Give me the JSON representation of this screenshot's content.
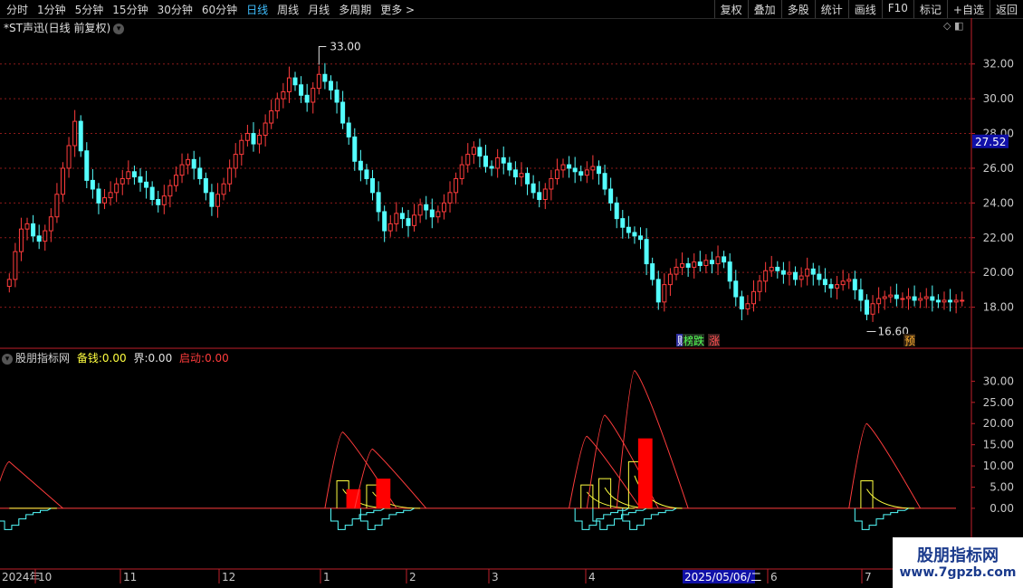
{
  "toolbar": {
    "periods": [
      "分时",
      "1分钟",
      "5分钟",
      "15分钟",
      "30分钟",
      "60分钟",
      "日线",
      "周线",
      "月线",
      "多周期",
      "更多 >"
    ],
    "active_period": "日线",
    "tools": [
      "复权",
      "叠加",
      "多股",
      "统计",
      "画线",
      "F10",
      "标记",
      "+自选",
      "返回"
    ]
  },
  "stock_title": "*ST声迅(日线 前复权)",
  "indicator": {
    "name": "股朋指标网",
    "beiqian_label": "备钱:",
    "beiqian_value": "0.00",
    "jie_label": "界:",
    "jie_value": "0.00",
    "qidong_label": "启动:",
    "qidong_value": "0.00"
  },
  "watermark": {
    "line1": "股朋指标网",
    "line2": "www.7gpzb.com"
  },
  "colors": {
    "up": "#ff3c3c",
    "down": "#54ffff",
    "axis": "#c0202a",
    "grid": "#8b1a1a",
    "label_bg": "#1010a8",
    "bar": "#ff0000",
    "yellow": "#ffff40",
    "cyan": "#54ffff",
    "white": "#ffffff",
    "text_tick": "#c8c8c8"
  },
  "chart_data": [
    {
      "type": "candlestick",
      "yticks": [
        18.0,
        20.0,
        22.0,
        24.0,
        26.0,
        28.0,
        30.0,
        32.0
      ],
      "ylim": [
        16.0,
        33.6
      ],
      "current_price": "27.52",
      "high_annotation": "33.00",
      "low_annotation": "16.60",
      "event_tags": [
        "财",
        "榜",
        "跌",
        "涨",
        "预"
      ],
      "closes": [
        19.6,
        21.2,
        22.5,
        22.8,
        22.1,
        21.8,
        22.4,
        23.2,
        24.5,
        26.0,
        27.3,
        28.7,
        27.0,
        25.3,
        24.8,
        24.0,
        24.3,
        24.6,
        25.1,
        25.4,
        25.8,
        25.5,
        25.2,
        24.9,
        24.2,
        23.9,
        24.4,
        25.0,
        25.6,
        26.2,
        26.5,
        26.0,
        25.4,
        24.6,
        23.8,
        24.5,
        25.1,
        26.0,
        26.8,
        27.6,
        28.0,
        27.4,
        27.9,
        28.6,
        29.3,
        30.0,
        30.4,
        31.2,
        30.8,
        30.2,
        29.8,
        30.6,
        31.4,
        31.0,
        30.5,
        29.8,
        28.6,
        27.8,
        26.4,
        25.9,
        25.4,
        24.6,
        23.5,
        22.4,
        22.8,
        23.4,
        23.1,
        22.7,
        23.3,
        23.9,
        23.6,
        23.2,
        23.5,
        24.0,
        24.6,
        25.4,
        26.2,
        26.8,
        27.2,
        26.7,
        26.1,
        26.0,
        26.6,
        26.3,
        25.9,
        25.5,
        25.7,
        25.1,
        24.6,
        24.2,
        24.8,
        25.4,
        25.9,
        26.2,
        26.0,
        25.8,
        25.6,
        25.9,
        26.1,
        25.7,
        24.8,
        24.0,
        23.1,
        22.6,
        22.3,
        22.1,
        21.9,
        20.5,
        19.6,
        18.3,
        19.3,
        19.9,
        20.3,
        20.5,
        20.3,
        20.6,
        20.4,
        20.7,
        20.5,
        20.9,
        20.6,
        19.5,
        18.6,
        17.9,
        18.2,
        18.9,
        19.5,
        20.1,
        20.3,
        20.1,
        19.9,
        20.0,
        19.6,
        19.8,
        20.2,
        19.9,
        19.6,
        19.3,
        19.1,
        19.3,
        19.5,
        19.6,
        19.0,
        18.4,
        17.6,
        18.2,
        18.5,
        18.6,
        18.7,
        18.5,
        18.5,
        18.6,
        18.4,
        18.5,
        18.6,
        18.4,
        18.3,
        18.4,
        18.3,
        18.4,
        18.4
      ]
    },
    {
      "type": "indicator",
      "yticks": [
        0.0,
        5.0,
        10.0,
        15.0,
        20.0,
        25.0,
        30.0
      ],
      "ylim": [
        -6.0,
        33.5
      ],
      "spikes": [
        {
          "day": 0,
          "peak": 11.0,
          "bar": 0,
          "box": 0
        },
        {
          "day": 56,
          "peak": 18.0,
          "bar": 4.5,
          "box": 6.5
        },
        {
          "day": 61,
          "peak": 14.0,
          "bar": 7.0,
          "box": 5.5
        },
        {
          "day": 97,
          "peak": 17.0,
          "bar": 0,
          "box": 5.5
        },
        {
          "day": 100,
          "peak": 22.0,
          "bar": 0,
          "box": 7.0
        },
        {
          "day": 105,
          "peak": 32.5,
          "bar": 16.5,
          "box": 11.0
        },
        {
          "day": 144,
          "peak": 20.0,
          "bar": 0,
          "box": 6.5
        }
      ],
      "dates": [
        "2024年",
        "10",
        "11",
        "12",
        "1",
        "2",
        "3",
        "4",
        "2025/05/06/二",
        "6",
        "7"
      ]
    }
  ]
}
